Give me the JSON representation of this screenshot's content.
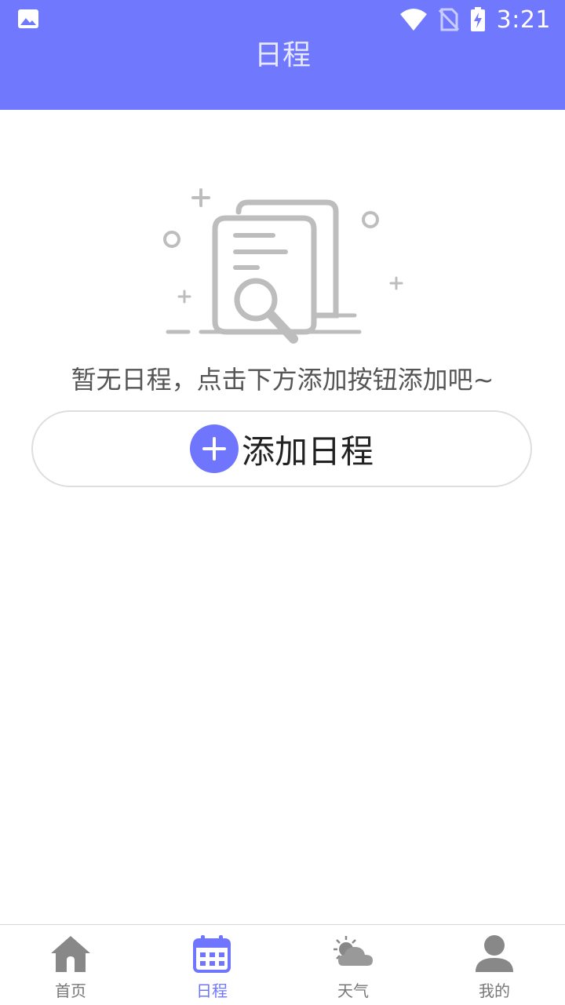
{
  "status_bar": {
    "time": "3:21"
  },
  "header": {
    "title": "日程"
  },
  "empty_state": {
    "message": "暂无日程，点击下方添加按钮添加吧~"
  },
  "add_button": {
    "label": "添加日程"
  },
  "tabs": [
    {
      "label": "首页",
      "icon": "home-icon",
      "active": false
    },
    {
      "label": "日程",
      "icon": "calendar-icon",
      "active": true
    },
    {
      "label": "天气",
      "icon": "weather-icon",
      "active": false
    },
    {
      "label": "我的",
      "icon": "profile-icon",
      "active": false
    }
  ],
  "colors": {
    "accent": "#6f76fd",
    "header_bg": "#7078fe",
    "muted_icon": "#888888"
  }
}
